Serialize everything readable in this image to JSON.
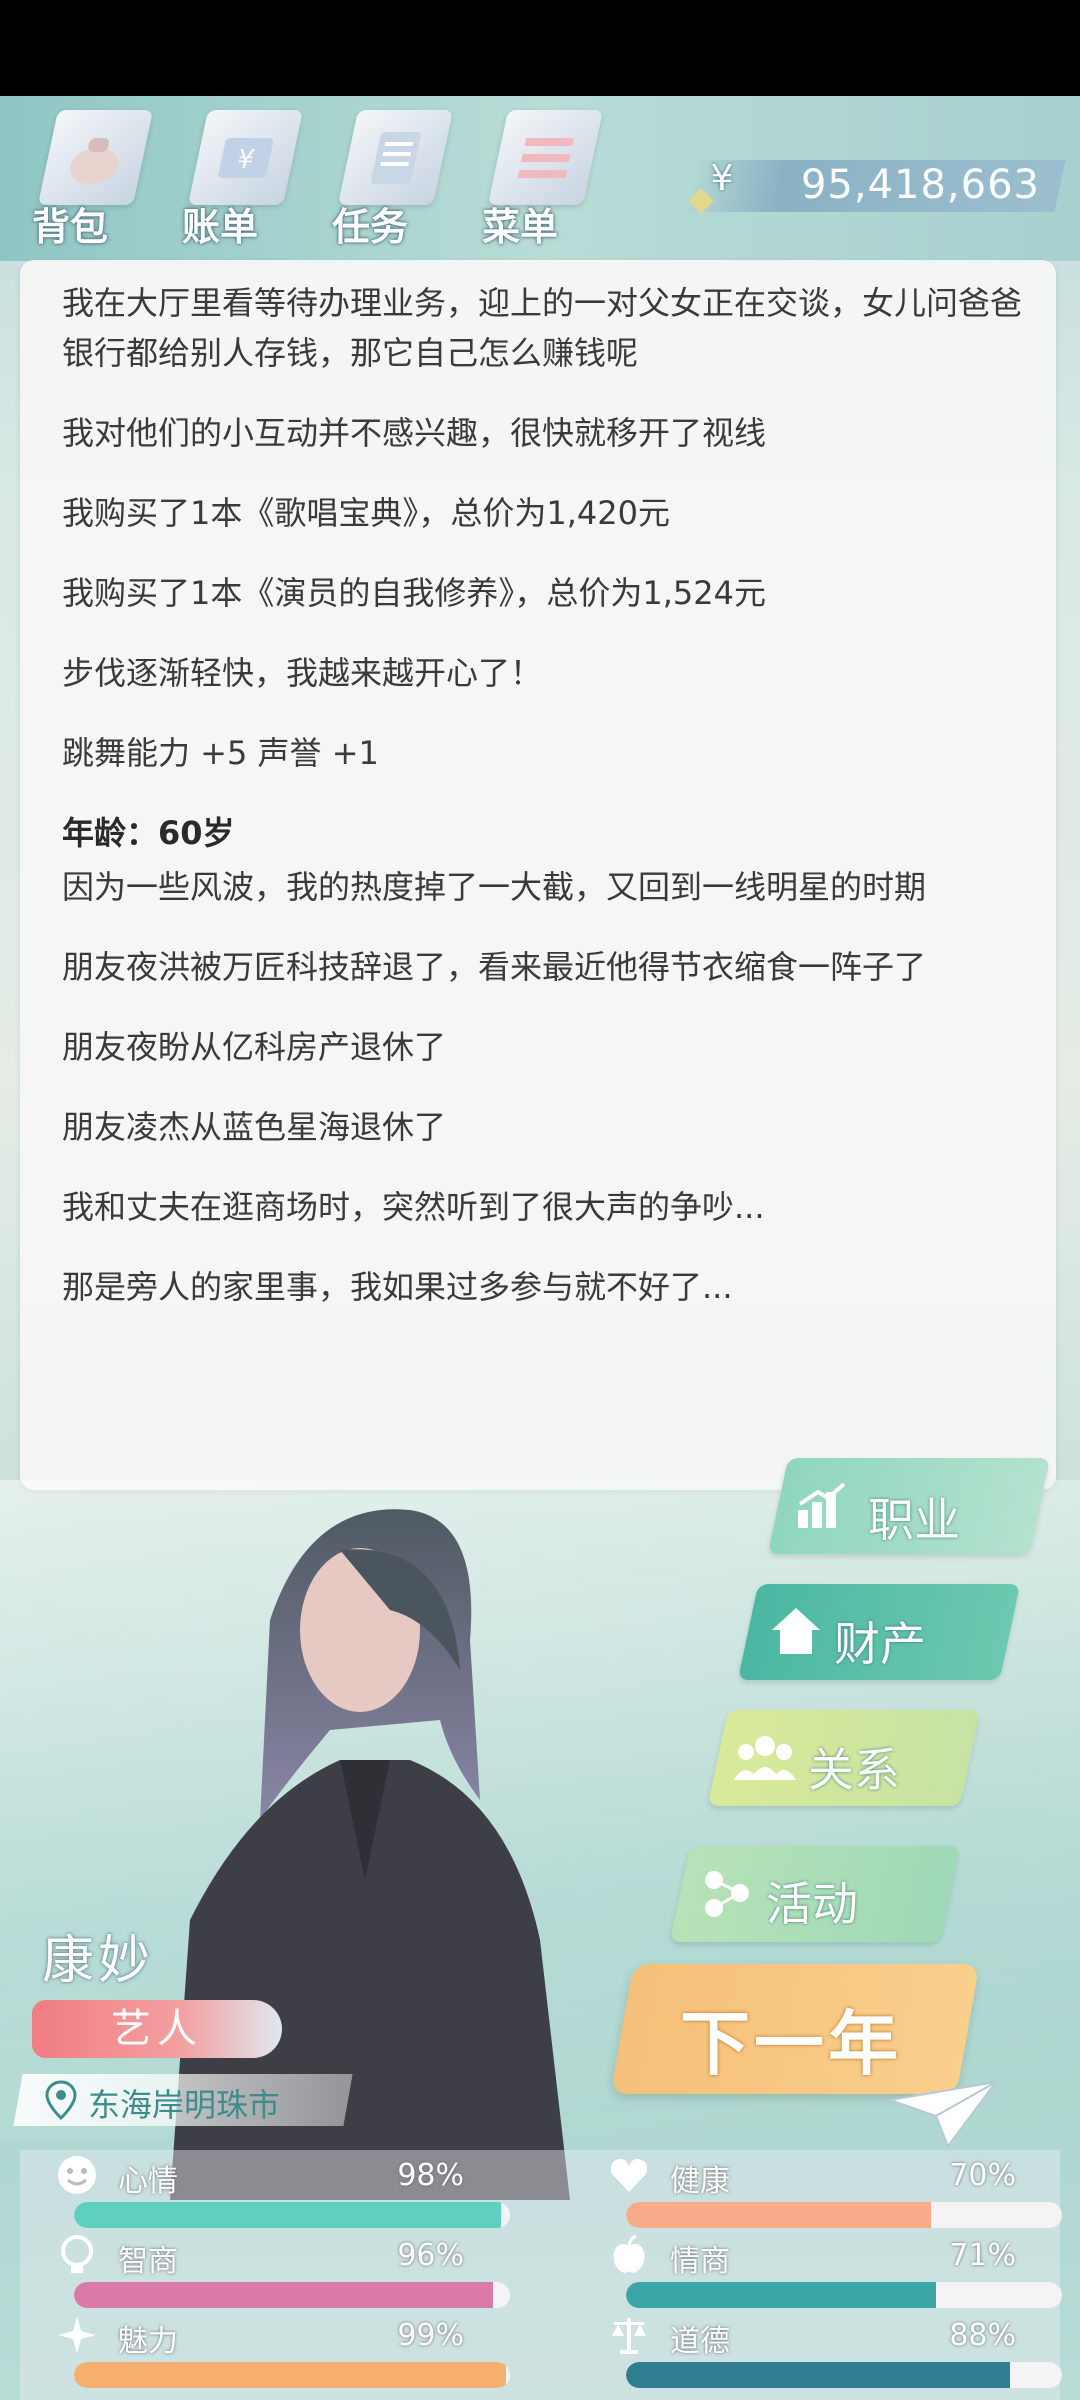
{
  "topnav": [
    {
      "label": "背包",
      "icon": "bag-icon"
    },
    {
      "label": "账单",
      "icon": "bill-icon"
    },
    {
      "label": "任务",
      "icon": "task-icon"
    },
    {
      "label": "菜单",
      "icon": "menu-icon"
    }
  ],
  "money": {
    "symbol": "¥",
    "value": "95,418,663"
  },
  "log": {
    "entries": [
      "我在大厅里看等待办理业务，迎上的一对父女正在交谈，女儿问爸爸银行都给别人存钱，那它自己怎么赚钱呢",
      "我对他们的小互动并不感兴趣，很快就移开了视线",
      "我购买了1本《歌唱宝典》，总价为1,420元",
      "我购买了1本《演员的自我修养》，总价为1,524元",
      "步伐逐渐轻快，我越来越开心了！",
      "跳舞能力 +5 声誉 +1"
    ],
    "age_label": "年龄：60岁",
    "age_entries": [
      "因为一些风波，我的热度掉了一大截，又回到一线明星的时期",
      "朋友夜洪被万匠科技辞退了，看来最近他得节衣缩食一阵子了",
      "朋友夜盼从亿科房产退休了",
      "朋友凌杰从蓝色星海退休了",
      "我和丈夫在逛商场时，突然听到了很大声的争吵...",
      "那是旁人的家里事，我如果过多参与就不好了..."
    ]
  },
  "character": {
    "name": "康妙",
    "job": "艺人",
    "location": "东海岸明珠市"
  },
  "menu": [
    {
      "label": "职业",
      "icon": "career-chart-icon"
    },
    {
      "label": "财产",
      "icon": "house-icon"
    },
    {
      "label": "关系",
      "icon": "people-icon"
    },
    {
      "label": "活动",
      "icon": "activity-icon"
    }
  ],
  "next_year": {
    "label": "下一年"
  },
  "stats": [
    {
      "name": "心情",
      "value": "98%",
      "fraction": 0.98,
      "color": "#5fcfc0",
      "icon": "smile-icon"
    },
    {
      "name": "健康",
      "value": "70%",
      "fraction": 0.7,
      "color": "#f7ab88",
      "icon": "heart-icon"
    },
    {
      "name": "智商",
      "value": "96%",
      "fraction": 0.96,
      "color": "#d97aa7",
      "icon": "bulb-icon"
    },
    {
      "name": "情商",
      "value": "71%",
      "fraction": 0.71,
      "color": "#3ca6a6",
      "icon": "apple-icon"
    },
    {
      "name": "魅力",
      "value": "99%",
      "fraction": 0.99,
      "color": "#f5b06f",
      "icon": "sparkle-icon"
    },
    {
      "name": "道德",
      "value": "88%",
      "fraction": 0.88,
      "color": "#2f7f90",
      "icon": "scale-icon"
    }
  ]
}
